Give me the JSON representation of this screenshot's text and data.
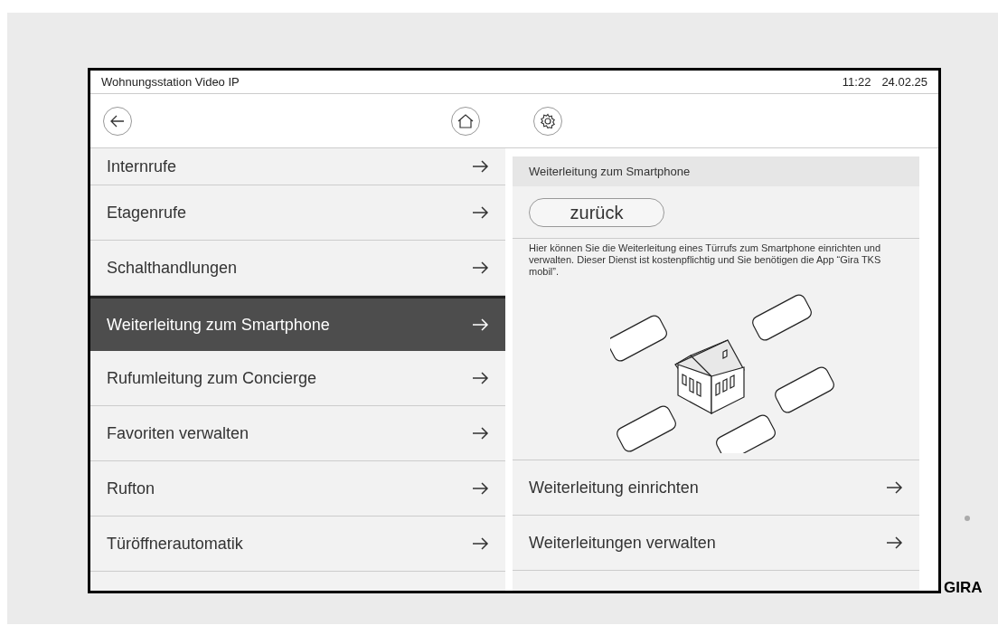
{
  "status_bar": {
    "title": "Wohnungsstation Video IP",
    "time": "11:22",
    "date": "24.02.25"
  },
  "menu": [
    {
      "label": "Internrufe",
      "selected": false
    },
    {
      "label": "Etagenrufe",
      "selected": false
    },
    {
      "label": "Schalthandlungen",
      "selected": false
    },
    {
      "label": "Weiterleitung zum Smartphone",
      "selected": true
    },
    {
      "label": "Rufumleitung zum Concierge",
      "selected": false
    },
    {
      "label": "Favoriten verwalten",
      "selected": false
    },
    {
      "label": "Rufton",
      "selected": false
    },
    {
      "label": "Türöffnerautomatik",
      "selected": false
    }
  ],
  "detail": {
    "header": "Weiterleitung zum Smartphone",
    "back_button": "zurück",
    "description": "Hier können Sie die Weiterleitung eines Türrufs zum Smartphone einrichten und verwalten. Dieser Dienst ist kostenpflichtig und Sie benötigen die App “Gira TKS mobil”.",
    "actions": [
      "Weiterleitung einrichten",
      "Weiterleitungen verwalten"
    ]
  },
  "brand": "GIRA"
}
